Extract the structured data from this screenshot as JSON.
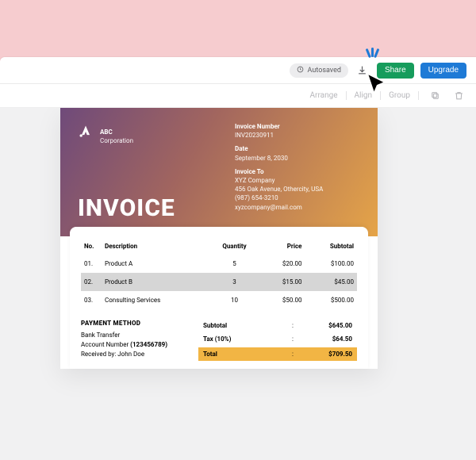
{
  "topbar": {
    "autosaved_label": "Autosaved",
    "share_label": "Share",
    "upgrade_label": "Upgrade"
  },
  "secondbar": {
    "arrange": "Arrange",
    "align": "Align",
    "group": "Group"
  },
  "doc": {
    "brand": {
      "name": "ABC",
      "sub": "Corporation"
    },
    "title": "INVOICE",
    "meta": {
      "invoice_number_label": "Invoice Number",
      "invoice_number": "INV20230911",
      "date_label": "Date",
      "date": "September 8, 2030",
      "to_label": "Invoice To",
      "to_name": "XYZ Company",
      "to_addr": "456 Oak Avenue, Othercity, USA",
      "to_phone": "(987) 654-3210",
      "to_email": "xyzcompany@mail.com"
    },
    "columns": {
      "no": "No.",
      "desc": "Description",
      "qty": "Quantity",
      "price": "Price",
      "subtotal": "Subtotal"
    },
    "rows": [
      {
        "no": "01.",
        "desc": "Product A",
        "qty": "5",
        "price": "$20.00",
        "subtotal": "$100.00"
      },
      {
        "no": "02.",
        "desc": "Product B",
        "qty": "3",
        "price": "$15.00",
        "subtotal": "$45.00"
      },
      {
        "no": "03.",
        "desc": "Consulting Services",
        "qty": "10",
        "price": "$50.00",
        "subtotal": "$500.00"
      }
    ],
    "payment": {
      "title": "PAYMENT METHOD",
      "line1": "Bank Transfer",
      "line2_prefix": "Account Number ",
      "line2_value": "(123456789)",
      "line3": "Received by: John Doe"
    },
    "summary": {
      "subtotal_label": "Subtotal",
      "subtotal_value": "$645.00",
      "tax_label": "Tax (10%)",
      "tax_value": "$64.50",
      "total_label": "Total",
      "total_value": "$709.50",
      "colon": ":"
    }
  }
}
